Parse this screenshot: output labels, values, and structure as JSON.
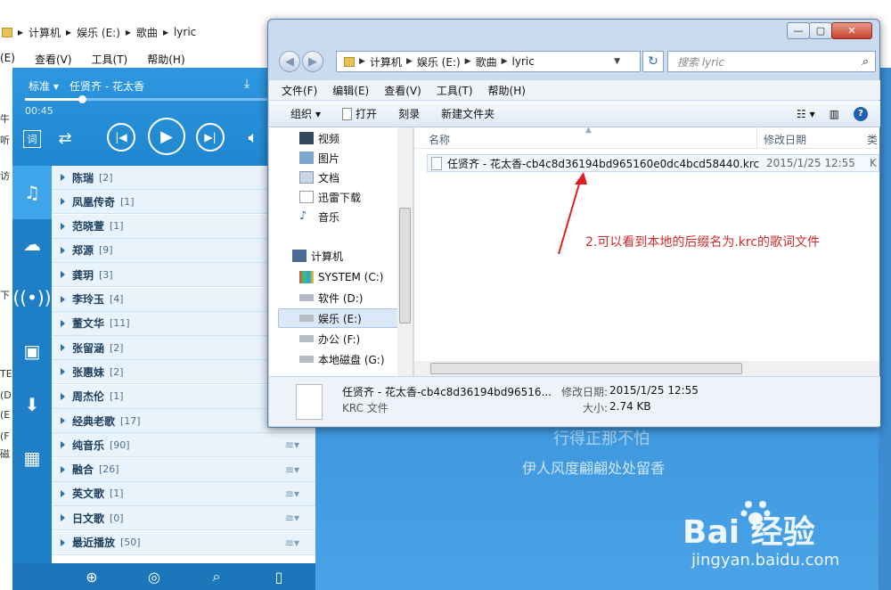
{
  "bg_explorer": {
    "breadcrumb": [
      "计算机",
      "娱乐 (E:)",
      "歌曲",
      "lyric"
    ],
    "menu": [
      "(E)",
      "查看(V)",
      "工具(T)",
      "帮助(H)"
    ],
    "side_text": [
      "牛",
      "听",
      "访",
      "下",
      "TE",
      "(D",
      "(E",
      "(F",
      "磁"
    ]
  },
  "player": {
    "mode": "标准",
    "song": "任贤齐 - 花太香",
    "time": "00:45",
    "progress_fraction": 0.2,
    "lyric_shown": "行得正那不怕",
    "lyric_next": "伊人风度翩翩处处留香",
    "playlists": [
      {
        "name": "陈瑞",
        "count": "[2]"
      },
      {
        "name": "凤凰传奇",
        "count": "[1]"
      },
      {
        "name": "范晓萱",
        "count": "[1]"
      },
      {
        "name": "郑源",
        "count": "[9]"
      },
      {
        "name": "龚玥",
        "count": "[3]"
      },
      {
        "name": "李玲玉",
        "count": "[4]"
      },
      {
        "name": "董文华",
        "count": "[11]"
      },
      {
        "name": "张留涵",
        "count": "[2]"
      },
      {
        "name": "张惠妹",
        "count": "[2]"
      },
      {
        "name": "周杰伦",
        "count": "[1]"
      },
      {
        "name": "经典老歌",
        "count": "[17]"
      },
      {
        "name": "纯音乐",
        "count": "[90]"
      },
      {
        "name": "融合",
        "count": "[26]"
      },
      {
        "name": "英文歌",
        "count": "[1]"
      },
      {
        "name": "日文歌",
        "count": "[0]"
      },
      {
        "name": "最近播放",
        "count": "[50]"
      }
    ],
    "menu_glyph": "≡▾"
  },
  "watermark": {
    "logo": "Bai 经验",
    "url": "jingyan.baidu.com"
  },
  "explorer": {
    "address": [
      "计算机",
      "娱乐 (E:)",
      "歌曲",
      "lyric"
    ],
    "search_placeholder": "搜索 lyric",
    "menu": [
      "文件(F)",
      "编辑(E)",
      "查看(V)",
      "工具(T)",
      "帮助(H)"
    ],
    "toolbar": {
      "organize": "组织",
      "open": "打开",
      "burn": "刻录",
      "new_folder": "新建文件夹"
    },
    "nav": {
      "libraries": [
        "视频",
        "图片",
        "文档",
        "迅雷下载",
        "音乐"
      ],
      "computer": "计算机",
      "drives": [
        "SYSTEM (C:)",
        "软件 (D:)",
        "娱乐 (E:)",
        "办公 (F:)",
        "本地磁盘 (G:)"
      ]
    },
    "columns": {
      "name": "名称",
      "date": "修改日期",
      "type": "类"
    },
    "file": {
      "name": "任贤齐 - 花太香-cb4c8d36194bd965160e0dc4bcd58440.krc",
      "date": "2015/1/25 12:55",
      "type": "K"
    },
    "annotation": "2.可以看到本地的后缀名为.krc的歌词文件",
    "details": {
      "name": "任贤齐 - 花太香-cb4c8d36194bd96516...",
      "modified_label": "修改日期:",
      "modified": "2015/1/25 12:55",
      "type": "KRC 文件",
      "size_label": "大小:",
      "size": "2.74 KB"
    }
  }
}
